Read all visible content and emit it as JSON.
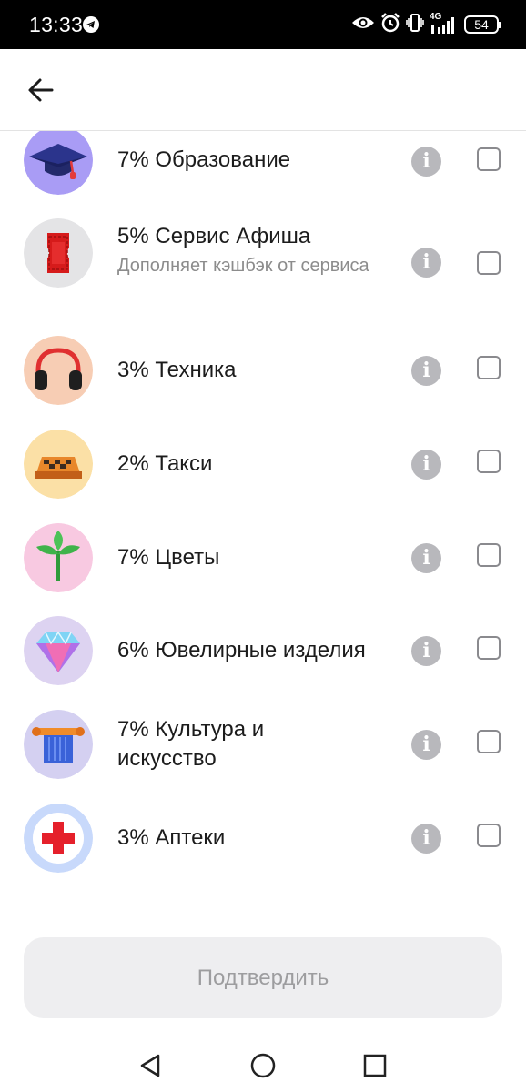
{
  "status_bar": {
    "time": "13:33",
    "network": "4G",
    "battery": "54",
    "icons": [
      "telegram-icon",
      "eye-icon",
      "alarm-icon",
      "vibrate-icon",
      "signal-icon",
      "battery-icon"
    ]
  },
  "header": {
    "back_icon": "arrow-left-icon"
  },
  "categories": [
    {
      "title": "7% Образование",
      "icon": "graduation-cap-icon",
      "bg": "#a99cf5",
      "checked": false
    },
    {
      "title": "5% Сервис Афиша",
      "subtitle": "Дополняет кэшбэк от сервиса",
      "icon": "ticket-icon",
      "bg": "#e4e4e6",
      "checked": false
    },
    {
      "title": "3% Техника",
      "icon": "headphones-icon",
      "bg": "#f7cdb4",
      "checked": false
    },
    {
      "title": "2% Такси",
      "icon": "taxi-sign-icon",
      "bg": "#fbe0a6",
      "checked": false
    },
    {
      "title": "7% Цветы",
      "icon": "plant-icon",
      "bg": "#f8c9e1",
      "checked": false
    },
    {
      "title": "6% Ювелирные изделия",
      "icon": "diamond-icon",
      "bg": "#ddd3f1",
      "checked": false
    },
    {
      "title": "7% Культура и искусство",
      "icon": "column-icon",
      "bg": "#d4d0f1",
      "checked": false
    },
    {
      "title": "3% Аптеки",
      "icon": "red-cross-icon",
      "bg": "#c8d9fb",
      "checked": false
    }
  ],
  "info_glyph": "i",
  "confirm_label": "Подтвердить",
  "colors": {
    "info": "#b8b8bc",
    "confirm_bg": "#eeeef0",
    "confirm_text": "#9d9d9f"
  },
  "navbar": {
    "icons": [
      "back-triangle-icon",
      "home-circle-icon",
      "recents-square-icon"
    ]
  }
}
